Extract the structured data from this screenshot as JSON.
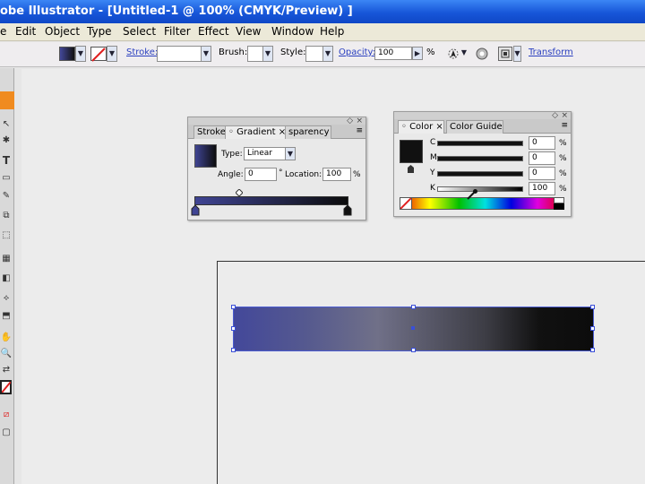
{
  "window": {
    "title": "obe Illustrator - [Untitled-1 @ 100% (CMYK/Preview) ]"
  },
  "menu": [
    "e",
    "Edit",
    "Object",
    "Type",
    "Select",
    "Filter",
    "Effect",
    "View",
    "Window",
    "Help"
  ],
  "control": {
    "stroke_label": "Stroke:",
    "brush_label": "Brush:",
    "style_label": "Style:",
    "opacity_label": "Opacity:",
    "opacity_value": "100",
    "percent": "%",
    "transform_label": "Transform"
  },
  "gradient_panel": {
    "tabs": [
      "Stroke",
      "Gradient",
      "sparency"
    ],
    "tab_close": "×",
    "type_label": "Type:",
    "type_value": "Linear",
    "angle_label": "Angle:",
    "angle_value": "0",
    "degree": "°",
    "location_label": "Location:",
    "location_value": "100",
    "percent": "%"
  },
  "color_panel": {
    "tabs": [
      "Color",
      "Color Guide"
    ],
    "tab_close": "×",
    "channels": [
      {
        "label": "C",
        "value": "0",
        "unit": "%"
      },
      {
        "label": "M",
        "value": "0",
        "unit": "%"
      },
      {
        "label": "Y",
        "value": "0",
        "unit": "%"
      },
      {
        "label": "K",
        "value": "100",
        "unit": "%"
      }
    ]
  },
  "colors": {
    "titlebar": "#1756d9",
    "gradient_start": "#43489a",
    "gradient_end": "#0c0c0c",
    "selection": "#3a4fd8",
    "tools_accent": "#f08b1f"
  }
}
